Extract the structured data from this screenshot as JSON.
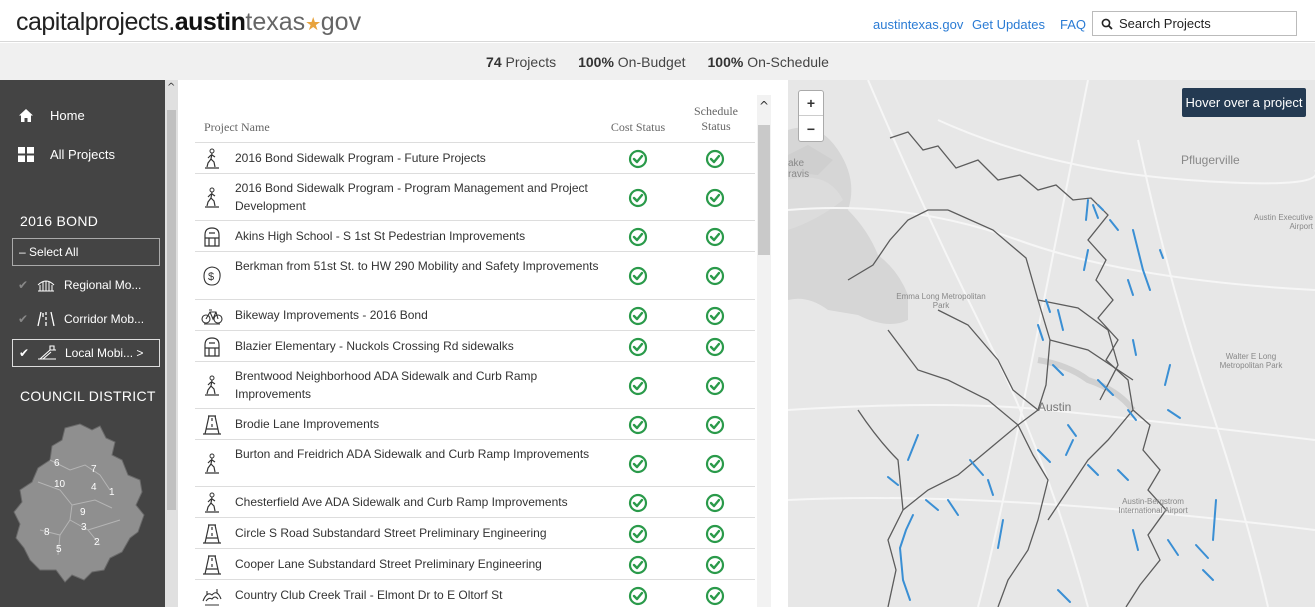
{
  "header": {
    "logo_part1": "capitalprojects.",
    "logo_part2": "austin",
    "logo_part3": "texas",
    "logo_star": "★",
    "logo_part4": "gov",
    "nav_links": [
      "austintexas.gov",
      "Get Updates",
      "FAQ"
    ],
    "search_label": "Search Projects"
  },
  "stats": {
    "projects_count": "74",
    "projects_label": "Projects",
    "budget_pct": "100%",
    "budget_label": "On-Budget",
    "schedule_pct": "100%",
    "schedule_label": "On-Schedule"
  },
  "sidebar": {
    "home_label": "Home",
    "all_projects_label": "All Projects",
    "bond_title": "2016 BOND",
    "select_all_label": "Select All",
    "filters": [
      {
        "label": "Regional Mo...",
        "icon": "regional-mobility-icon",
        "active": false
      },
      {
        "label": "Corridor Mob...",
        "icon": "corridor-mobility-icon",
        "active": false
      },
      {
        "label": "Local Mobi... >",
        "icon": "local-mobility-icon",
        "active": true
      }
    ],
    "district_title": "COUNCIL DISTRICT",
    "district_numbers": [
      "6",
      "7",
      "10",
      "4",
      "1",
      "9",
      "8",
      "3",
      "2",
      "5"
    ]
  },
  "table": {
    "col_name": "Project Name",
    "col_cost": "Cost Status",
    "col_schedule_line1": "Schedule",
    "col_schedule_line2": "Status",
    "rows": [
      {
        "name": "2016 Bond Sidewalk Program - Future Projects",
        "icon": "pedestrian-icon"
      },
      {
        "name": "2016 Bond Sidewalk Program - Program Management and Project Development",
        "icon": "pedestrian-icon"
      },
      {
        "name": "Akins High School - S 1st St Pedestrian Improvements",
        "icon": "school-icon"
      },
      {
        "name": "Berkman from 51st St. to HW 290 Mobility and Safety Improvements",
        "icon": "safety-icon"
      },
      {
        "name": "Bikeway Improvements - 2016 Bond",
        "icon": "bicycle-icon"
      },
      {
        "name": "Blazier Elementary - Nuckols Crossing Rd sidewalks",
        "icon": "school-icon"
      },
      {
        "name": "Brentwood Neighborhood ADA Sidewalk and Curb Ramp Improvements",
        "icon": "pedestrian-icon"
      },
      {
        "name": "Brodie Lane Improvements",
        "icon": "road-icon"
      },
      {
        "name": "Burton and Freidrich ADA Sidewalk and Curb Ramp Improvements",
        "icon": "pedestrian-icon"
      },
      {
        "name": "Chesterfield Ave ADA Sidewalk and Curb Ramp Improvements",
        "icon": "pedestrian-icon"
      },
      {
        "name": "Circle S Road Substandard Street Preliminary Engineering",
        "icon": "road-icon"
      },
      {
        "name": "Cooper Lane Substandard Street Preliminary Engineering",
        "icon": "road-icon"
      },
      {
        "name": "Country Club Creek Trail - Elmont Dr to E Oltorf St",
        "icon": "trail-icon"
      }
    ]
  },
  "map": {
    "zoom_in": "+",
    "zoom_out": "−",
    "hover_text": "Hover over a project",
    "labels": {
      "lake": "ake",
      "travis": "ravis",
      "pflugerville": "Pflugerville",
      "exec_airport_1": "Austin Executive",
      "exec_airport_2": "Airport",
      "emma_1": "Emma Long Metropolitan",
      "emma_2": "Park",
      "walter_1": "Walter E Long",
      "walter_2": "Metropolitan Park",
      "austin": "Austin",
      "abia_1": "Austin-Bergstrom",
      "abia_2": "International Airport"
    }
  },
  "colors": {
    "status_green": "#2a9a4a",
    "sidebar_bg": "#444444",
    "link_blue": "#2a7bd4",
    "hover_box": "#243a52",
    "project_line": "#3a8fd4"
  }
}
